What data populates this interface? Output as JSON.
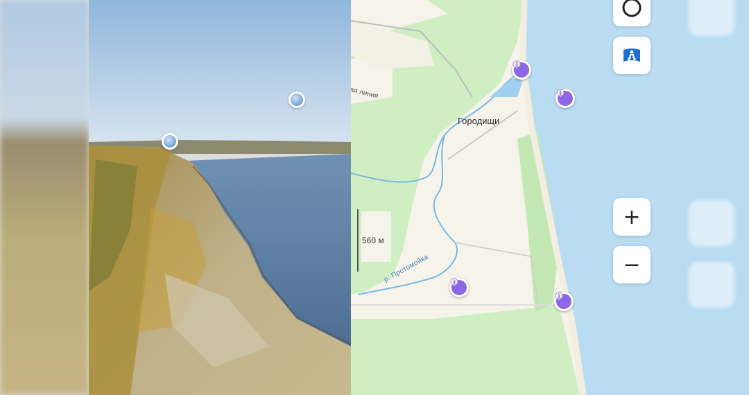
{
  "map": {
    "village_label": "Городищи",
    "road_label": "ая линия",
    "river_label": "р. Протомойка",
    "scale_label": "560 м"
  },
  "colors": {
    "water": "#b9dcf3",
    "forest": "#cfeec2",
    "land": "#f6f3ea",
    "river": "#76b9e3",
    "poi_accent": "#8d68e6"
  },
  "controls": {
    "compass_icon": "compass-ring-icon",
    "panorama_icon": "panorama-person-icon",
    "zoom_in_symbol": "+",
    "zoom_out_symbol": "−"
  },
  "pois": [
    {
      "id": "poi-1",
      "icon": "balloon-icon"
    },
    {
      "id": "poi-2",
      "icon": "balloon-icon"
    },
    {
      "id": "poi-3",
      "icon": "balloon-icon"
    },
    {
      "id": "poi-4",
      "icon": "balloon-icon"
    }
  ],
  "photo_markers": [
    {
      "id": "photo-pin-1",
      "icon": "balloon-icon"
    },
    {
      "id": "photo-pin-2",
      "icon": "balloon-icon"
    }
  ]
}
